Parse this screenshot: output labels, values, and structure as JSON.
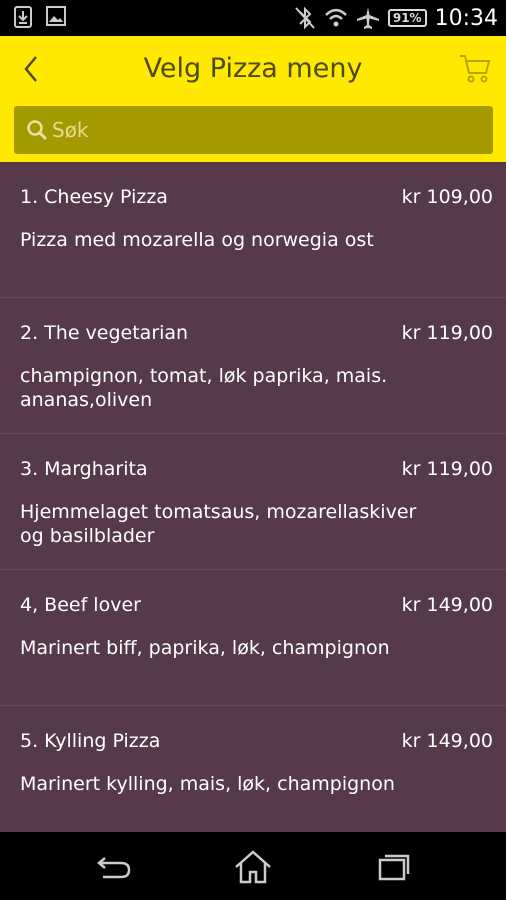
{
  "status_bar": {
    "battery": "91%",
    "time": "10:34",
    "icons": [
      "download-icon",
      "image-icon",
      "bluetooth-off-icon",
      "wifi-icon",
      "airplane-icon",
      "battery-icon"
    ]
  },
  "header": {
    "title": "Velg Pizza meny",
    "back_icon": "chevron-left-icon",
    "cart_icon": "cart-icon",
    "background": "#ffe900"
  },
  "search": {
    "placeholder": "Søk",
    "value": ""
  },
  "menu": {
    "items": [
      {
        "name": "1. Cheesy Pizza",
        "price": "kr 109,00",
        "description": "Pizza med mozarella og norwegia ost"
      },
      {
        "name": "2. The vegetarian",
        "price": "kr 119,00",
        "description": "champignon, tomat, løk paprika, mais. ananas,oliven"
      },
      {
        "name": "3. Margharita",
        "price": "kr 119,00",
        "description": "Hjemmelaget tomatsaus, mozarellaskiver og basilblader"
      },
      {
        "name": "4, Beef lover",
        "price": "kr 149,00",
        "description": "Marinert biff, paprika, løk, champignon"
      },
      {
        "name": "5. Kylling Pizza",
        "price": "kr 149,00",
        "description": "Marinert kylling, mais, løk, champignon"
      }
    ],
    "background": "#56394b"
  },
  "nav_bar": {
    "icons": [
      "back-icon",
      "home-icon",
      "recents-icon"
    ]
  }
}
